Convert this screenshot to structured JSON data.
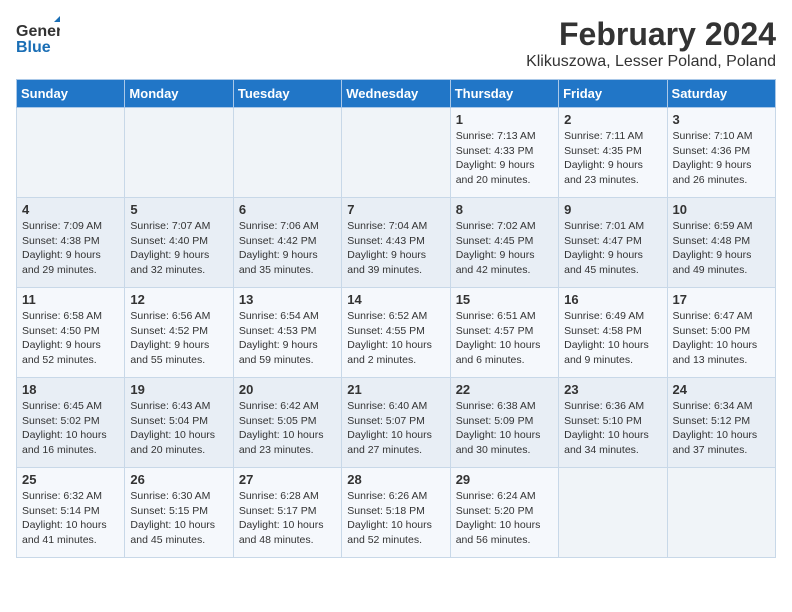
{
  "header": {
    "logo_line1": "General",
    "logo_line2": "Blue",
    "title": "February 2024",
    "subtitle": "Klikuszowa, Lesser Poland, Poland"
  },
  "days_of_week": [
    "Sunday",
    "Monday",
    "Tuesday",
    "Wednesday",
    "Thursday",
    "Friday",
    "Saturday"
  ],
  "weeks": [
    [
      {
        "day": "",
        "detail": ""
      },
      {
        "day": "",
        "detail": ""
      },
      {
        "day": "",
        "detail": ""
      },
      {
        "day": "",
        "detail": ""
      },
      {
        "day": "1",
        "detail": "Sunrise: 7:13 AM\nSunset: 4:33 PM\nDaylight: 9 hours\nand 20 minutes."
      },
      {
        "day": "2",
        "detail": "Sunrise: 7:11 AM\nSunset: 4:35 PM\nDaylight: 9 hours\nand 23 minutes."
      },
      {
        "day": "3",
        "detail": "Sunrise: 7:10 AM\nSunset: 4:36 PM\nDaylight: 9 hours\nand 26 minutes."
      }
    ],
    [
      {
        "day": "4",
        "detail": "Sunrise: 7:09 AM\nSunset: 4:38 PM\nDaylight: 9 hours\nand 29 minutes."
      },
      {
        "day": "5",
        "detail": "Sunrise: 7:07 AM\nSunset: 4:40 PM\nDaylight: 9 hours\nand 32 minutes."
      },
      {
        "day": "6",
        "detail": "Sunrise: 7:06 AM\nSunset: 4:42 PM\nDaylight: 9 hours\nand 35 minutes."
      },
      {
        "day": "7",
        "detail": "Sunrise: 7:04 AM\nSunset: 4:43 PM\nDaylight: 9 hours\nand 39 minutes."
      },
      {
        "day": "8",
        "detail": "Sunrise: 7:02 AM\nSunset: 4:45 PM\nDaylight: 9 hours\nand 42 minutes."
      },
      {
        "day": "9",
        "detail": "Sunrise: 7:01 AM\nSunset: 4:47 PM\nDaylight: 9 hours\nand 45 minutes."
      },
      {
        "day": "10",
        "detail": "Sunrise: 6:59 AM\nSunset: 4:48 PM\nDaylight: 9 hours\nand 49 minutes."
      }
    ],
    [
      {
        "day": "11",
        "detail": "Sunrise: 6:58 AM\nSunset: 4:50 PM\nDaylight: 9 hours\nand 52 minutes."
      },
      {
        "day": "12",
        "detail": "Sunrise: 6:56 AM\nSunset: 4:52 PM\nDaylight: 9 hours\nand 55 minutes."
      },
      {
        "day": "13",
        "detail": "Sunrise: 6:54 AM\nSunset: 4:53 PM\nDaylight: 9 hours\nand 59 minutes."
      },
      {
        "day": "14",
        "detail": "Sunrise: 6:52 AM\nSunset: 4:55 PM\nDaylight: 10 hours\nand 2 minutes."
      },
      {
        "day": "15",
        "detail": "Sunrise: 6:51 AM\nSunset: 4:57 PM\nDaylight: 10 hours\nand 6 minutes."
      },
      {
        "day": "16",
        "detail": "Sunrise: 6:49 AM\nSunset: 4:58 PM\nDaylight: 10 hours\nand 9 minutes."
      },
      {
        "day": "17",
        "detail": "Sunrise: 6:47 AM\nSunset: 5:00 PM\nDaylight: 10 hours\nand 13 minutes."
      }
    ],
    [
      {
        "day": "18",
        "detail": "Sunrise: 6:45 AM\nSunset: 5:02 PM\nDaylight: 10 hours\nand 16 minutes."
      },
      {
        "day": "19",
        "detail": "Sunrise: 6:43 AM\nSunset: 5:04 PM\nDaylight: 10 hours\nand 20 minutes."
      },
      {
        "day": "20",
        "detail": "Sunrise: 6:42 AM\nSunset: 5:05 PM\nDaylight: 10 hours\nand 23 minutes."
      },
      {
        "day": "21",
        "detail": "Sunrise: 6:40 AM\nSunset: 5:07 PM\nDaylight: 10 hours\nand 27 minutes."
      },
      {
        "day": "22",
        "detail": "Sunrise: 6:38 AM\nSunset: 5:09 PM\nDaylight: 10 hours\nand 30 minutes."
      },
      {
        "day": "23",
        "detail": "Sunrise: 6:36 AM\nSunset: 5:10 PM\nDaylight: 10 hours\nand 34 minutes."
      },
      {
        "day": "24",
        "detail": "Sunrise: 6:34 AM\nSunset: 5:12 PM\nDaylight: 10 hours\nand 37 minutes."
      }
    ],
    [
      {
        "day": "25",
        "detail": "Sunrise: 6:32 AM\nSunset: 5:14 PM\nDaylight: 10 hours\nand 41 minutes."
      },
      {
        "day": "26",
        "detail": "Sunrise: 6:30 AM\nSunset: 5:15 PM\nDaylight: 10 hours\nand 45 minutes."
      },
      {
        "day": "27",
        "detail": "Sunrise: 6:28 AM\nSunset: 5:17 PM\nDaylight: 10 hours\nand 48 minutes."
      },
      {
        "day": "28",
        "detail": "Sunrise: 6:26 AM\nSunset: 5:18 PM\nDaylight: 10 hours\nand 52 minutes."
      },
      {
        "day": "29",
        "detail": "Sunrise: 6:24 AM\nSunset: 5:20 PM\nDaylight: 10 hours\nand 56 minutes."
      },
      {
        "day": "",
        "detail": ""
      },
      {
        "day": "",
        "detail": ""
      }
    ]
  ]
}
